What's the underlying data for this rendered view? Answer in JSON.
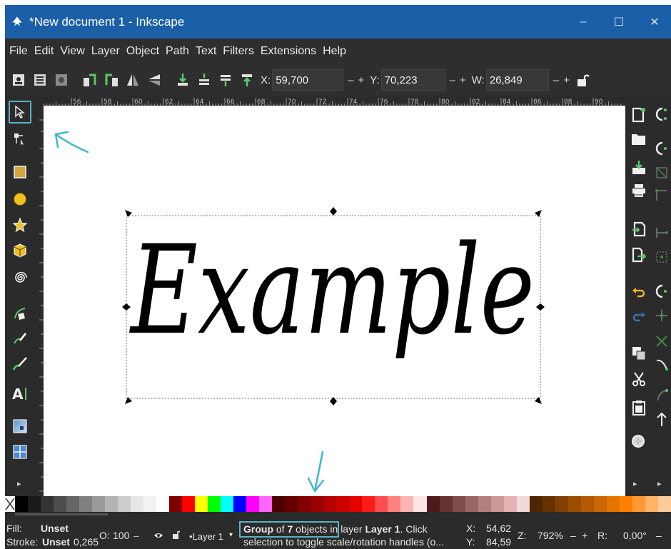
{
  "window": {
    "title": "*New document 1 - Inkscape",
    "controls": {
      "minimize": "–",
      "maximize": "☐",
      "close": "✕"
    }
  },
  "menu": [
    "File",
    "Edit",
    "View",
    "Layer",
    "Object",
    "Path",
    "Text",
    "Filters",
    "Extensions",
    "Help"
  ],
  "toolcontrols": {
    "x_label": "X:",
    "x_value": "59,700",
    "y_label": "Y:",
    "y_value": "70,223",
    "w_label": "W:",
    "w_value": "26,849",
    "minus": "–",
    "plus": "+"
  },
  "ruler_labels": [
    "56",
    "58",
    "60",
    "62",
    "64",
    "66",
    "68",
    "70",
    "72",
    "74",
    "76",
    "78",
    "80",
    "82",
    "84",
    "86",
    "88",
    "90",
    "92"
  ],
  "canvas": {
    "text": "Example"
  },
  "status": {
    "fill_label": "Fill:",
    "fill_value": "Unset",
    "stroke_label": "Stroke:",
    "stroke_value": "Unset",
    "stroke_width": "0,265",
    "opacity_label": "O:",
    "opacity_value": "100",
    "layer_value": "•Layer 1",
    "msg_part1": "Group",
    "msg_part2": " of ",
    "msg_part3": "7",
    "msg_part4": " objects",
    "msg_part5": " in layer ",
    "msg_part6": "Layer 1",
    "msg_part7": ". Click",
    "msg_line2": "selection to toggle scale/rotation handles (o...",
    "cursor_x_label": "X:",
    "cursor_x": "54,62",
    "cursor_y_label": "Y:",
    "cursor_y": "84,59",
    "zoom_label": "Z:",
    "zoom_value": "792%",
    "rotate_label": "R:",
    "rotate_value": "0,00°"
  },
  "colors": {
    "titlebar": "#1b5fa8",
    "accent": "#56b4c6",
    "annotation": "#3fb6cf"
  },
  "icons": [
    "inkscape-logo-icon",
    "selector-arrow-icon",
    "node-tool-icon",
    "rectangle-tool-icon",
    "circle-tool-icon",
    "star-tool-icon",
    "box-3d-tool-icon",
    "spiral-tool-icon",
    "pen-tool-icon",
    "pencil-tool-icon",
    "calligraphy-tool-icon",
    "text-tool-icon",
    "gradient-tool-icon",
    "mesh-tool-icon",
    "lock-icon",
    "new-document-icon",
    "open-icon",
    "save-icon",
    "print-icon",
    "import-icon",
    "export-icon",
    "undo-icon",
    "redo-icon",
    "duplicate-icon",
    "cut-icon",
    "paste-icon",
    "zoom-icon",
    "eye-icon"
  ]
}
